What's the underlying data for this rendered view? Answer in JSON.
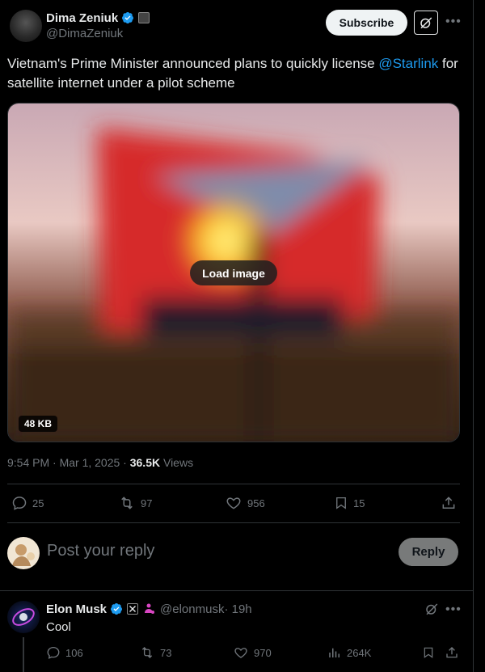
{
  "author": {
    "name": "Dima Zeniuk",
    "handle": "@DimaZeniuk"
  },
  "header": {
    "subscribe_label": "Subscribe"
  },
  "tweet": {
    "text_before": "Vietnam's Prime Minister announced plans to quickly license ",
    "mention": "@Starlink",
    "text_after": " for satellite internet under a pilot scheme",
    "media": {
      "load_label": "Load image",
      "size_label": "48 KB"
    },
    "time": "9:54 PM · Mar 1, 2025 · ",
    "views_count": "36.5K",
    "views_label": " Views",
    "stats": {
      "replies": "25",
      "reposts": "97",
      "likes": "956",
      "bookmarks": "15"
    }
  },
  "composer": {
    "placeholder": "Post your reply",
    "reply_label": "Reply"
  },
  "reply": {
    "name": "Elon Musk",
    "handle": "@elonmusk",
    "time": " · 19h",
    "text": "Cool",
    "stats": {
      "replies": "106",
      "reposts": "73",
      "likes": "970",
      "views": "264K"
    }
  },
  "colors": {
    "accent": "#1d9bf0",
    "background": "#000000",
    "muted": "#71767b"
  }
}
